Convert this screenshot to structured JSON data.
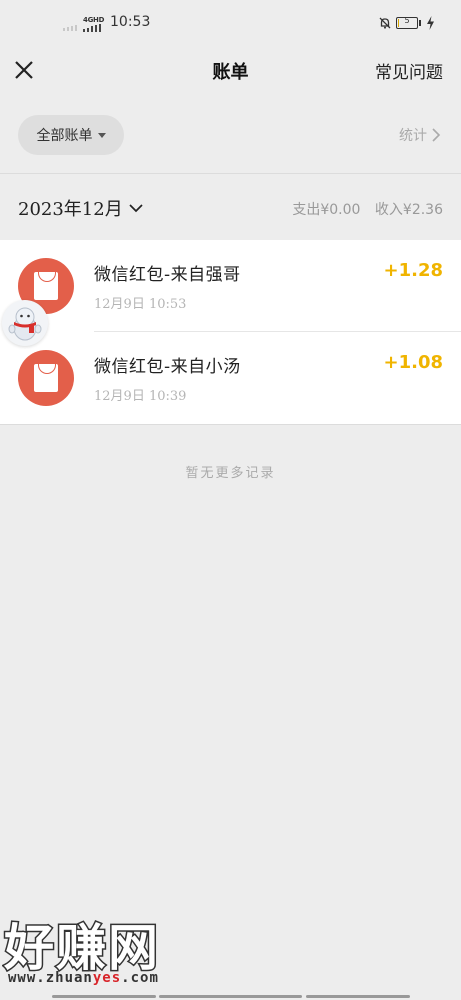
{
  "status_bar": {
    "network": "4GHD",
    "time": "10:53",
    "battery_level": "5"
  },
  "nav": {
    "title": "账单",
    "faq_label": "常见问题"
  },
  "filter": {
    "all_bills_label": "全部账单",
    "stats_label": "统计"
  },
  "month": {
    "label": "2023年12月",
    "expense_label": "支出",
    "expense_value": "¥0.00",
    "income_label": "收入",
    "income_value": "¥2.36"
  },
  "transactions": [
    {
      "title": "微信红包-来自强哥",
      "time": "12月9日  10:53",
      "amount": "+1.28"
    },
    {
      "title": "微信红包-来自小汤",
      "time": "12月9日  10:39",
      "amount": "+1.08"
    }
  ],
  "footer": {
    "no_more_text": "暂无更多记录"
  },
  "watermark": {
    "logo_text": "好赚网",
    "url_prefix": "www.zhuan",
    "url_highlight": "yes",
    "url_suffix": ".com"
  },
  "colors": {
    "red_packet": "#e35f4a",
    "income_amount": "#f0b400",
    "background": "#ededed"
  }
}
